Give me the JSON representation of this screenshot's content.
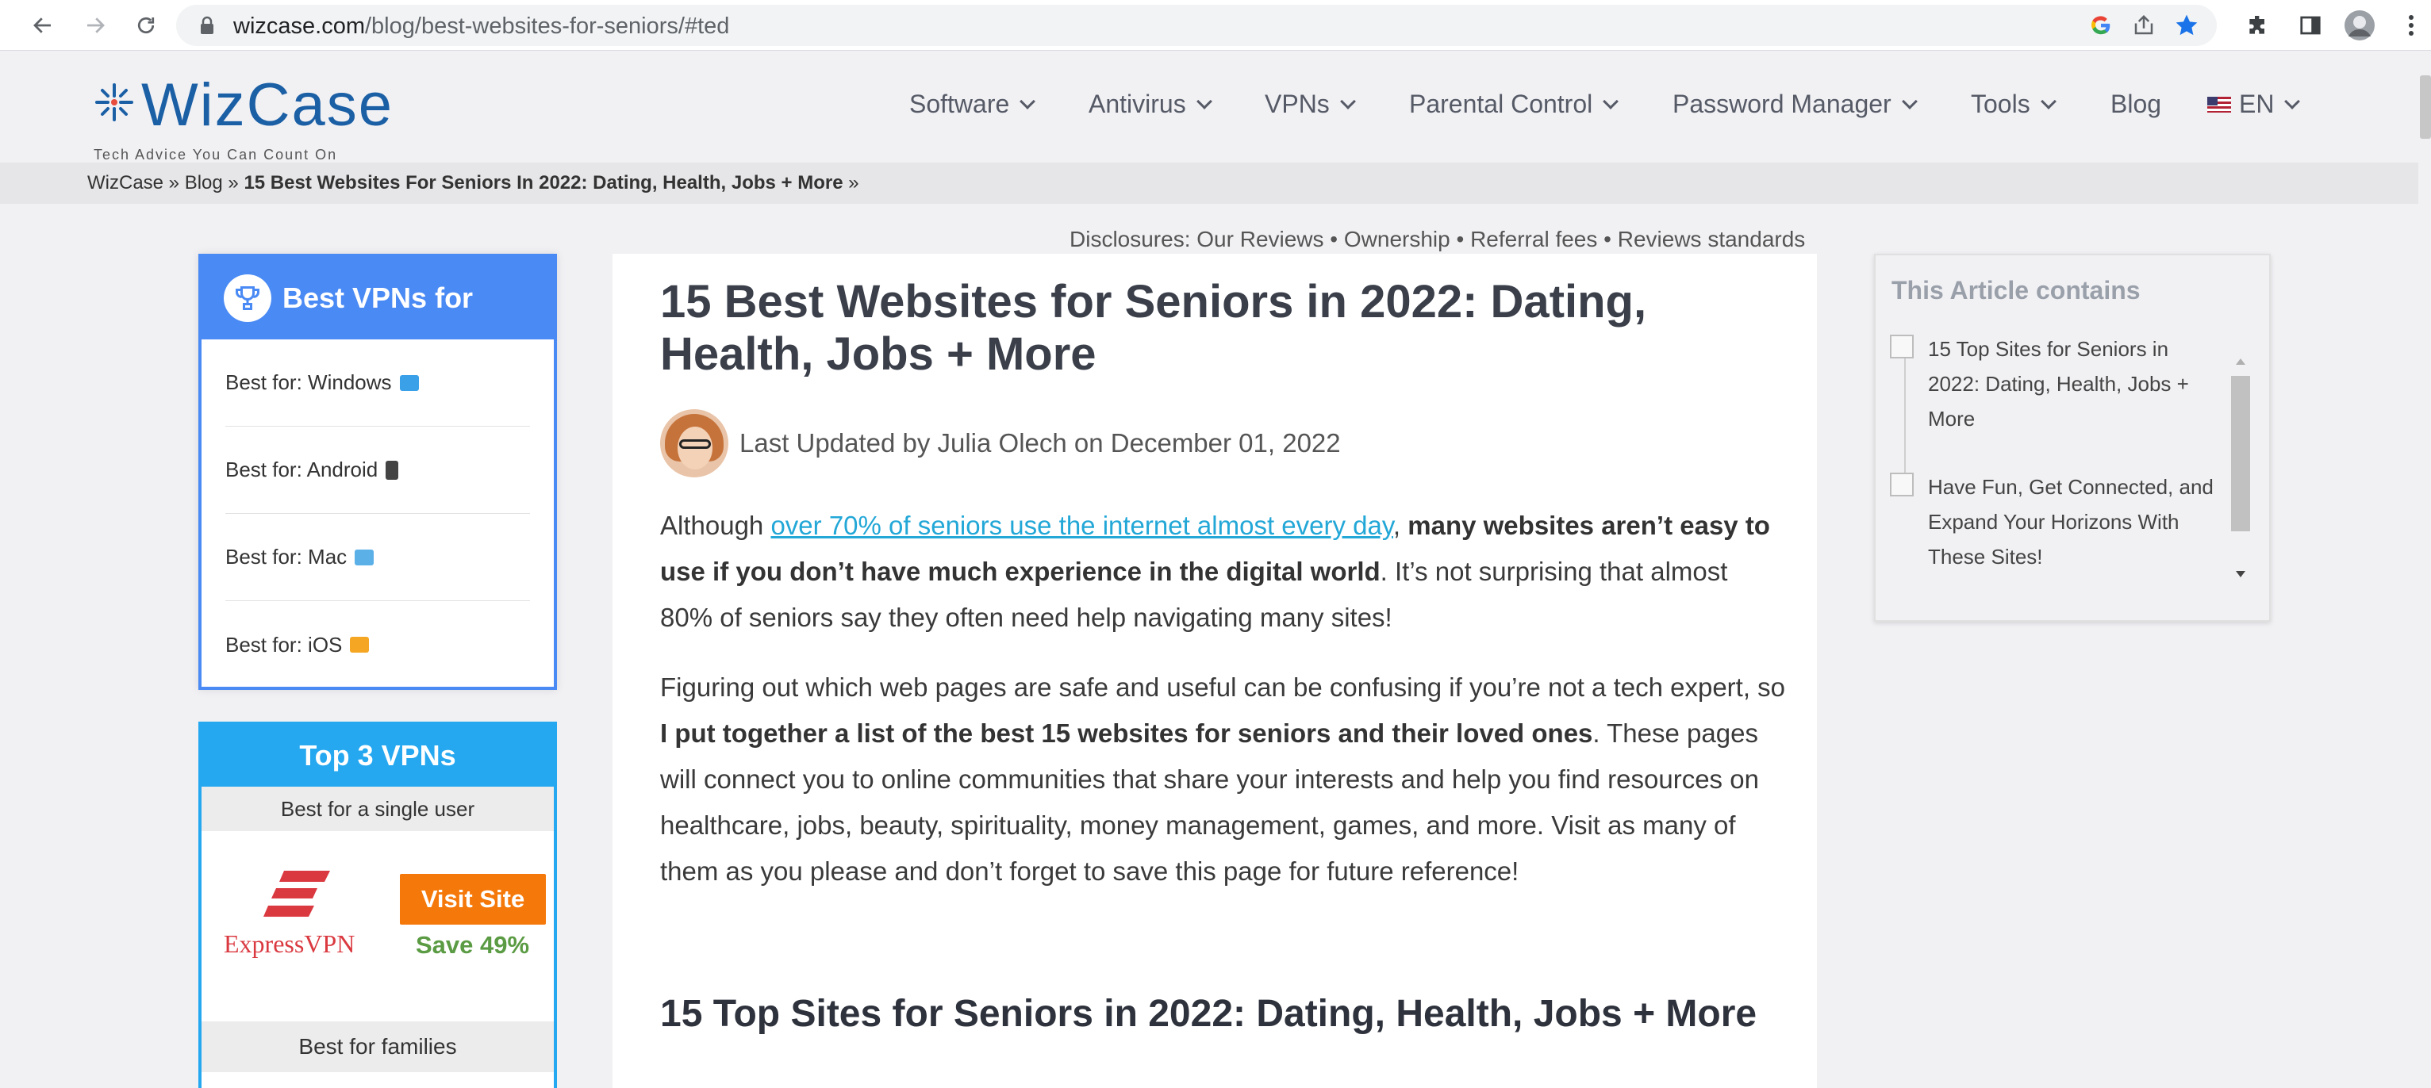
{
  "browser": {
    "url_domain": "wizcase.com",
    "url_path": "/blog/best-websites-for-seniors/#ted"
  },
  "site": {
    "logo_text": "WizCase",
    "tagline": "Tech Advice You Can Count On",
    "menu": [
      {
        "label": "Software"
      },
      {
        "label": "Antivirus"
      },
      {
        "label": "VPNs"
      },
      {
        "label": "Parental Control"
      },
      {
        "label": "Password Manager"
      },
      {
        "label": "Tools"
      },
      {
        "label": "Blog"
      },
      {
        "label": "EN"
      }
    ]
  },
  "breadcrumb": {
    "home": "WizCase",
    "sep1": " » ",
    "blog": "Blog",
    "sep2": " » ",
    "current": "15 Best Websites For Seniors In 2022: Dating, Health, Jobs + More",
    "sep3": " »"
  },
  "disclosures": "Disclosures: Our Reviews • Ownership • Referral fees • Reviews standards",
  "vpn_box": {
    "title": "Best VPNs for",
    "items": [
      {
        "label": "Best for: Windows",
        "icon": "monitor-icon",
        "color": "#3aa0e8"
      },
      {
        "label": "Best for: Android",
        "icon": "phone-icon",
        "color": "#444444"
      },
      {
        "label": "Best for: Mac",
        "icon": "laptop-icon",
        "color": "#5bb0e8"
      },
      {
        "label": "Best for: iOS",
        "icon": "ios-icon",
        "color": "#f5a623"
      }
    ]
  },
  "top3": {
    "title": "Top 3 VPNs",
    "sub1": "Best for a single user",
    "provider": "ExpressVPN",
    "visit": "Visit Site",
    "save": "Save 49%",
    "sub2": "Best for families"
  },
  "article": {
    "title": "15 Best Websites for Seniors in 2022: Dating, Health, Jobs + More",
    "author_line": "Last Updated by Julia Olech on December 01, 2022",
    "p1_a": "Although ",
    "p1_link": "over 70% of seniors use the internet almost every day",
    "p1_b": ", ",
    "p1_bold": "many websites aren’t easy to use if you don’t have much experience in the digital world",
    "p1_c": ". It’s not surprising that almost 80% of seniors say they often need help navigating many sites!",
    "p2_a": "Figuring out which web pages are safe and useful can be confusing if you’re not a tech expert, so ",
    "p2_bold": "I put together a list of the best 15 websites for seniors and their loved ones",
    "p2_b": ". These pages will connect you to online communities that share your interests and help you find resources on healthcare, jobs, beauty, spirituality, money management, games, and more. Visit as many of them as you please and don’t forget to save this page for future reference!",
    "h2": "15 Top Sites for Seniors in 2022: Dating, Health, Jobs + More"
  },
  "toc": {
    "title": "This Article contains",
    "items": [
      {
        "label": "15 Top Sites for Seniors in 2022: Dating, Health, Jobs + More"
      },
      {
        "label": "Have Fun, Get Connected, and Expand Your Horizons With These Sites!"
      }
    ]
  },
  "colors": {
    "accent_blue": "#4a8af4",
    "top3_blue": "#25a8f0",
    "cta_orange": "#f5780a",
    "save_green": "#5a9b43",
    "link": "#22a7d7"
  }
}
